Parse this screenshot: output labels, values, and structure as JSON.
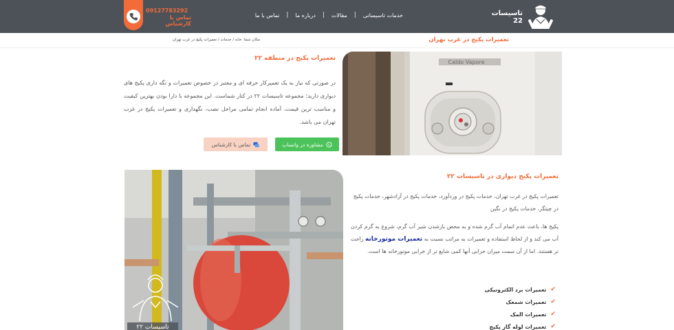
{
  "header": {
    "brand": "تاسیسات 22",
    "nav": [
      {
        "label": "خدمات تاسیساتی"
      },
      {
        "label": "مقالات"
      },
      {
        "label": "درباره ما"
      },
      {
        "label": "تماس با ما"
      }
    ],
    "phone_number": "09127783292",
    "phone_label": "تماس با کارشناس"
  },
  "page_title": "تعمیرات پکیج در غرب تهران",
  "breadcrumb": "مکان شما: خانه / خدمات / تعمیرات پکیج در غرب تهران",
  "section1": {
    "title": "تعمیرات پکیج در منطقه ۲۲",
    "text": "در صورتی که نیاز به یک تعمیرکار حرفه ای و معتبر در خصوص تعمیرات و نگه داری پکیج های دیواری دارید؛ مجموعه تاسیسات ۲۲ در کنار شماست. این مجموعه با دارا بودن بهترین کیفیت و مناسب ترین قیمت، آماده انجام تمامی مراحل نصب، نگهداری و تعمیرات پکیج در غرب تهران می باشد.",
    "whatsapp_button": "مشاوره در واتساپ",
    "call_button": "تماس با کارشناس"
  },
  "section2": {
    "title": "تعمیرات پکیج دیواری در تاسیسات ۲۲",
    "p1": "تعمیرات پکیج در غرب تهران، خدمات پکیج در وردآورد، خدمات پکیج در آزادشهر، خدمات پکیج در چیتگر، خدمات پکیج در نگین",
    "p2_before": "پکیج ها، باعث عدم اتمام آب گرم شده و به محض بازشدن شیر آب گرم، شروع به گرم کردن آب می کند و از لحاظ استفاده و تعمیرات به مراتب نسبت به ",
    "p2_link": "تعمیرات موتورخانه",
    "p2_after": " راحت تر هستند. اما از آن سمت میزان خرابی آنها کمی شایع تر از خرابی موتورخانه ها است.",
    "features": [
      "تعمیرات برد الکترونیکی",
      "تعمیرات شمعک",
      "تعمیرات المک",
      "تعمیرات لوله گاز پکیج"
    ],
    "image_caption": "تاسیسات ۲۲"
  },
  "colors": {
    "header_bg": "#4d5259",
    "accent": "#f26b38",
    "whatsapp": "#4cc35a",
    "call_button_bg": "#f8d2c3",
    "link": "#1a2aa0"
  },
  "icons": [
    "plumber-logo-icon",
    "phone-icon",
    "whatsapp-icon",
    "chat-icon",
    "check-icon"
  ]
}
